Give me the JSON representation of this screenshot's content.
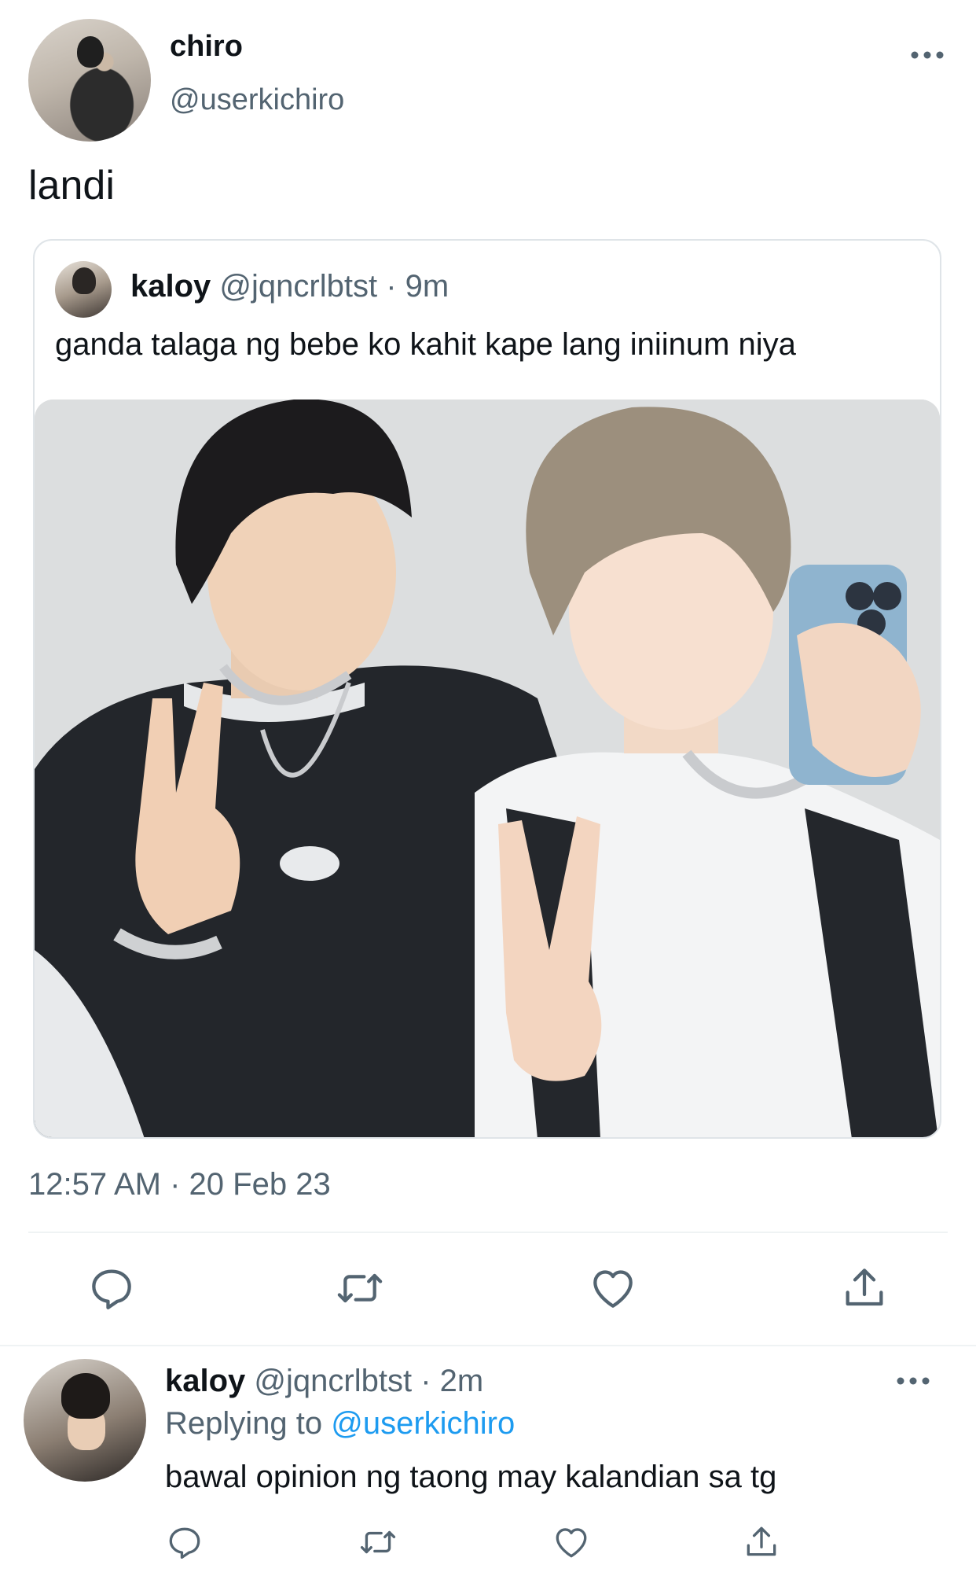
{
  "main_tweet": {
    "display_name": "chiro",
    "handle": "@userkichiro",
    "text": "landi",
    "timestamp": "12:57 AM · 20 Feb 23",
    "more_icon": "more-horizontal-icon"
  },
  "quoted_tweet": {
    "display_name": "kaloy",
    "handle": "@jqncrlbtst",
    "separator": " · ",
    "time_ago": "9m",
    "text": "ganda talaga ng bebe ko kahit kape lang iniinum niya"
  },
  "actions": [
    {
      "icon": "reply-icon"
    },
    {
      "icon": "retweet-icon"
    },
    {
      "icon": "like-icon"
    },
    {
      "icon": "share-icon"
    }
  ],
  "reply": {
    "display_name": "kaloy",
    "handle": "@jqncrlbtst",
    "separator": " · ",
    "time_ago": "2m",
    "replying_prefix": "Replying to ",
    "replying_handle": "@userkichiro",
    "text": "bawal opinion ng taong may kalandian sa tg",
    "more_icon": "more-horizontal-icon"
  },
  "colors": {
    "text_primary": "#0f1419",
    "text_secondary": "#536471",
    "link": "#1d9bf0",
    "divider": "#eff3f4",
    "icon": "#536471"
  }
}
